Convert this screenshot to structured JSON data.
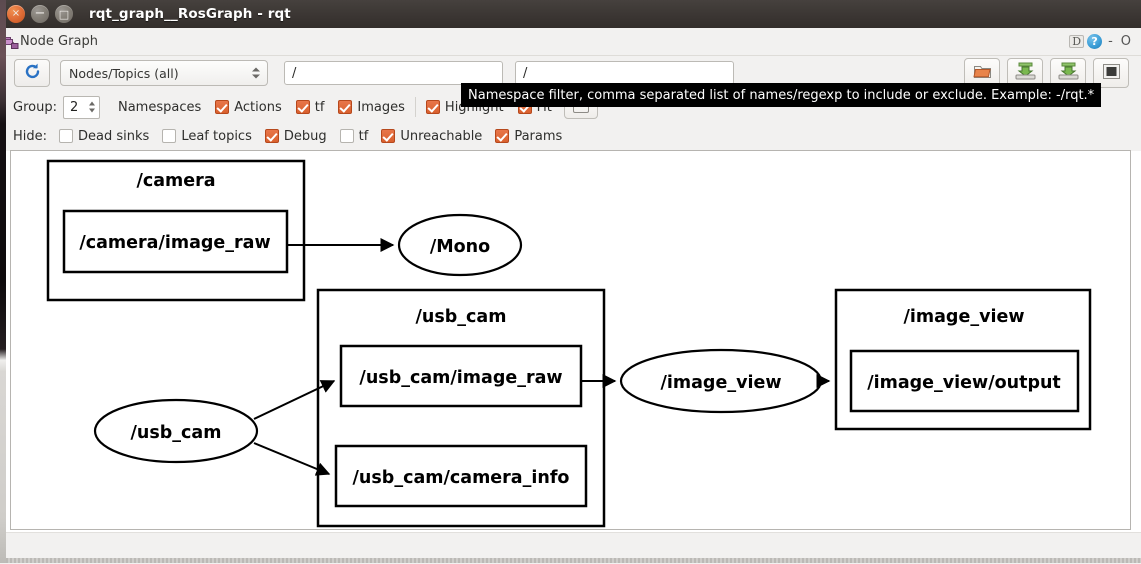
{
  "window": {
    "title": "rqt_graph__RosGraph - rqt",
    "buttons": {
      "close": "×",
      "minimize": "−",
      "maximize": "□"
    }
  },
  "dock": {
    "title": "Node Graph",
    "icon": "node-graph-icon",
    "undock_label": "D",
    "help_label": "?",
    "minimize_label": "-",
    "close_label": "O"
  },
  "toolbar": {
    "refresh_icon": "refresh-icon",
    "graph_type": "Nodes/Topics (all)",
    "filter_value": "/",
    "namespace_value": "/",
    "buttons": [
      {
        "name": "load-dot-button",
        "icon": "folder-icon"
      },
      {
        "name": "save-dot-button",
        "icon": "save-dot-icon"
      },
      {
        "name": "save-image-button",
        "icon": "save-image-icon"
      },
      {
        "name": "screenshot-button",
        "icon": "screenshot-icon"
      }
    ]
  },
  "options": {
    "group_label": "Group:",
    "group_value": "2",
    "namespaces_label": "Namespaces",
    "checkboxes": [
      {
        "label": "Actions",
        "checked": true
      },
      {
        "label": "tf",
        "checked": true
      },
      {
        "label": "Images",
        "checked": true
      },
      {
        "label": "Highlight",
        "checked": true
      },
      {
        "label": "Fit",
        "checked": true
      }
    ],
    "fit_button_icon": "fit-in-view-icon"
  },
  "hide_row": {
    "label": "Hide:",
    "checkboxes": [
      {
        "label": "Dead sinks",
        "checked": false
      },
      {
        "label": "Leaf topics",
        "checked": false
      },
      {
        "label": "Debug",
        "checked": true
      },
      {
        "label": "tf",
        "checked": false
      },
      {
        "label": "Unreachable",
        "checked": true
      },
      {
        "label": "Params",
        "checked": true
      }
    ]
  },
  "tooltip": {
    "text": "Namespace filter, comma separated list of names/regexp to include or exclude. Example: -/rqt.*"
  },
  "graph": {
    "clusters": [
      {
        "id": "camera",
        "label": "/camera"
      },
      {
        "id": "usb_cam",
        "label": "/usb_cam"
      },
      {
        "id": "image_view",
        "label": "/image_view"
      }
    ],
    "topics": [
      {
        "id": "camera_image_raw",
        "label": "/camera/image_raw"
      },
      {
        "id": "usb_cam_image_raw",
        "label": "/usb_cam/image_raw"
      },
      {
        "id": "usb_cam_camera_info",
        "label": "/usb_cam/camera_info"
      },
      {
        "id": "image_view_output",
        "label": "/image_view/output"
      }
    ],
    "nodes": [
      {
        "id": "mono",
        "label": "/Mono"
      },
      {
        "id": "usb_cam_node",
        "label": "/usb_cam"
      },
      {
        "id": "image_view_node",
        "label": "/image_view"
      }
    ],
    "edges": [
      {
        "from": "camera_image_raw",
        "to": "mono"
      },
      {
        "from": "usb_cam_node",
        "to": "usb_cam_image_raw"
      },
      {
        "from": "usb_cam_node",
        "to": "usb_cam_camera_info"
      },
      {
        "from": "usb_cam_image_raw",
        "to": "image_view_node"
      },
      {
        "from": "image_view_node",
        "to": "image_view_output"
      }
    ]
  }
}
